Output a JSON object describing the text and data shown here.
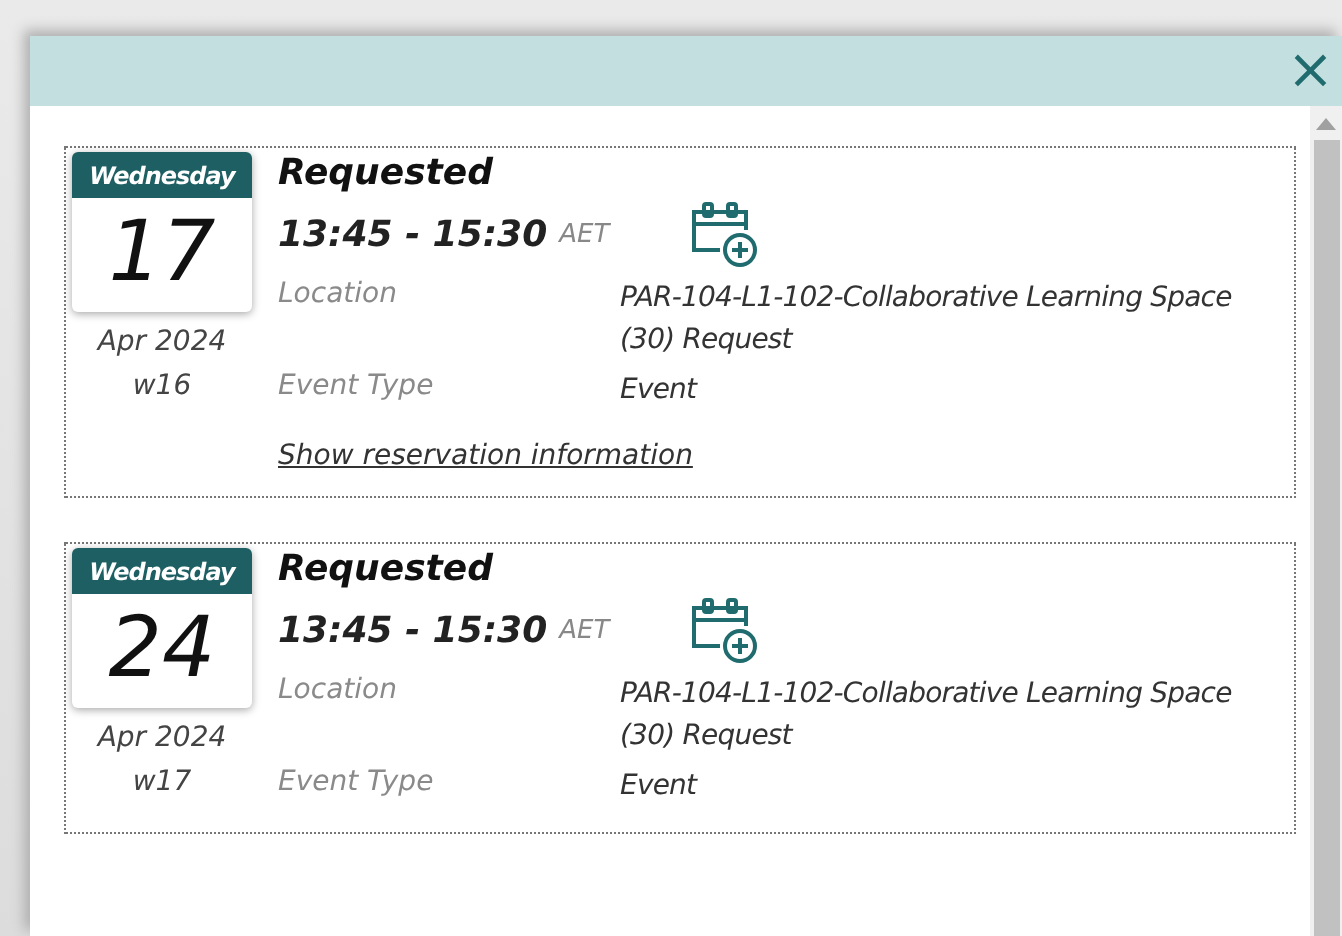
{
  "dialog": {
    "close": "×"
  },
  "reservations": [
    {
      "weekday": "Wednesday",
      "day": "17",
      "month_year": "Apr 2024",
      "week": "w16",
      "status": "Requested",
      "time": "13:45 - 15:30",
      "timezone": "AET",
      "fields": [
        {
          "label": "Location",
          "value": "PAR-104-L1-102-Collaborative Learning Space (30) Request"
        },
        {
          "label": "Event Type",
          "value": "Event"
        }
      ],
      "link": "Show reservation information"
    },
    {
      "weekday": "Wednesday",
      "day": "24",
      "month_year": "Apr 2024",
      "week": "w17",
      "status": "Requested",
      "time": "13:45 - 15:30",
      "timezone": "AET",
      "fields": [
        {
          "label": "Location",
          "value": "PAR-104-L1-102-Collaborative Learning Space (30) Request"
        },
        {
          "label": "Event Type",
          "value": "Event"
        }
      ]
    }
  ]
}
